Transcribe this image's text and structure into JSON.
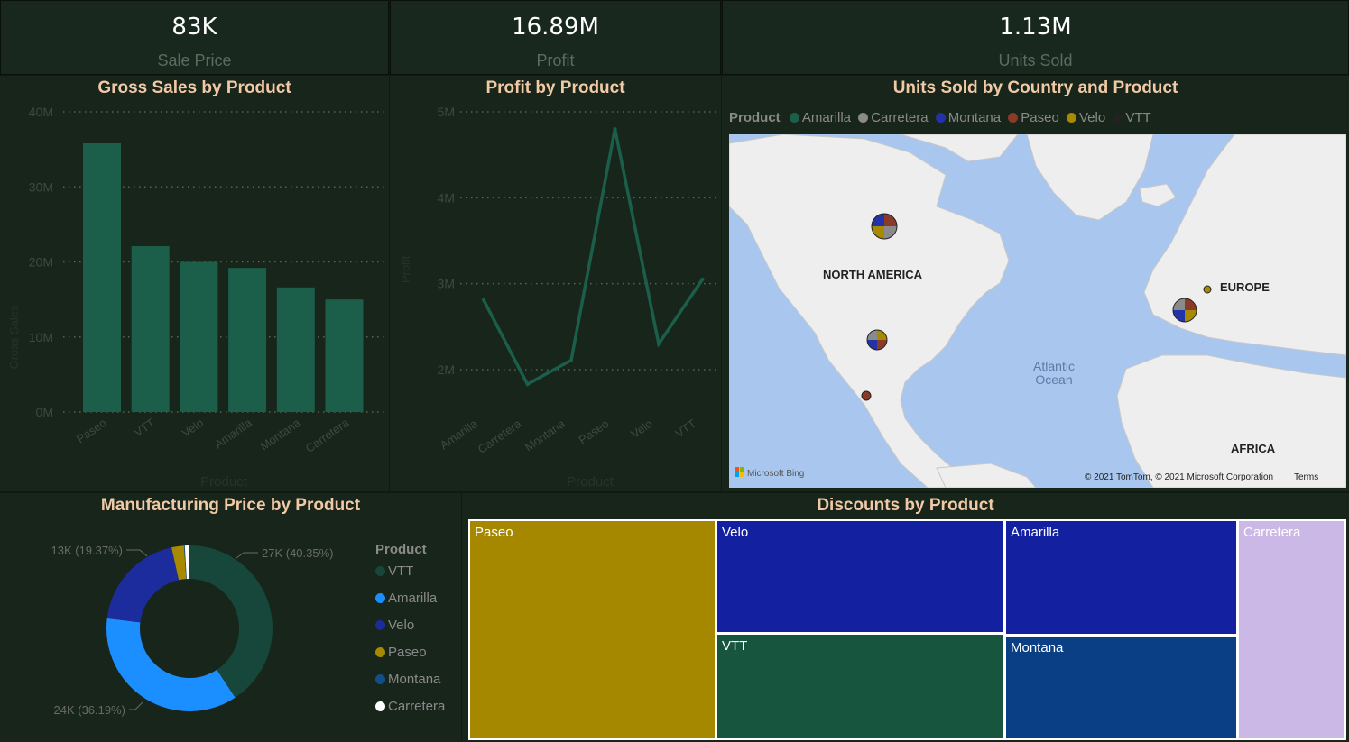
{
  "kpis": [
    {
      "value": "83K",
      "label": "Sale Price"
    },
    {
      "value": "16.89M",
      "label": "Profit"
    },
    {
      "value": "1.13M",
      "label": "Units Sold"
    }
  ],
  "gross_sales": {
    "title": "Gross Sales by Product",
    "y_ticks": [
      "0M",
      "10M",
      "20M",
      "30M",
      "40M"
    ],
    "xlabel": "Product",
    "ylabel": "Gross Sales"
  },
  "profit": {
    "title": "Profit by Product",
    "y_ticks": [
      "2M",
      "3M",
      "4M",
      "5M"
    ],
    "xlabel": "Product",
    "ylabel": "Profit"
  },
  "map": {
    "title": "Units Sold by Country and Product",
    "legend_title": "Product",
    "legend": [
      {
        "name": "Amarilla",
        "color": "#1b5e4a"
      },
      {
        "name": "Carretera",
        "color": "#8a8a8a"
      },
      {
        "name": "Montana",
        "color": "#2233aa"
      },
      {
        "name": "Paseo",
        "color": "#8b3a2a"
      },
      {
        "name": "Velo",
        "color": "#a88a00"
      },
      {
        "name": "VTT",
        "color": "#222222"
      }
    ],
    "labels": {
      "north_america": "NORTH AMERICA",
      "europe": "EUROPE",
      "atlantic": "Atlantic",
      "ocean": "Ocean",
      "africa": "AFRICA"
    },
    "bing": "Microsoft Bing",
    "copyright": "© 2021 TomTom, © 2021 Microsoft Corporation",
    "terms": "Terms"
  },
  "manufacturing": {
    "title": "Manufacturing Price by Product",
    "legend_title": "Product",
    "legend": [
      {
        "name": "VTT",
        "color": "#17463a"
      },
      {
        "name": "Amarilla",
        "color": "#1b8fff"
      },
      {
        "name": "Velo",
        "color": "#1c2c9c"
      },
      {
        "name": "Paseo",
        "color": "#a88a00"
      },
      {
        "name": "Montana",
        "color": "#114f8a"
      },
      {
        "name": "Carretera",
        "color": "#ffffff"
      }
    ],
    "labels": {
      "vtt": "27K (40.35%)",
      "amarilla": "24K (36.19%)",
      "velo": "13K (19.37%)"
    }
  },
  "discounts": {
    "title": "Discounts by Product",
    "tiles": [
      "Paseo",
      "Velo",
      "Amarilla",
      "Carretera",
      "VTT",
      "Montana"
    ]
  },
  "chart_data": [
    {
      "type": "bar",
      "title": "Gross Sales by Product",
      "xlabel": "Product",
      "ylabel": "Gross Sales",
      "categories": [
        "Paseo",
        "VTT",
        "Velo",
        "Amarilla",
        "Montana",
        "Carretera"
      ],
      "values": [
        35.8,
        22.1,
        20.0,
        19.2,
        16.6,
        15.0
      ],
      "unit": "M",
      "ylim": [
        0,
        40
      ],
      "color": "#1b5e4a",
      "grid": true
    },
    {
      "type": "line",
      "title": "Profit by Product",
      "xlabel": "Product",
      "ylabel": "Profit",
      "categories": [
        "Amarilla",
        "Carretera",
        "Montana",
        "Paseo",
        "Velo",
        "VTT"
      ],
      "values": [
        2.81,
        1.83,
        2.11,
        4.8,
        2.3,
        3.05
      ],
      "unit": "M",
      "ylim": [
        1.5,
        5
      ],
      "color": "#1b5e4a",
      "grid": true
    },
    {
      "type": "pie",
      "title": "Manufacturing Price by Product",
      "categories": [
        "VTT",
        "Amarilla",
        "Velo",
        "Paseo",
        "Montana",
        "Carretera"
      ],
      "values": [
        27,
        24,
        13,
        1.6,
        0.1,
        0.6
      ],
      "percent": [
        40.35,
        36.19,
        19.37,
        2.4,
        0.15,
        0.9
      ],
      "unit": "K",
      "colors": [
        "#17463a",
        "#1b8fff",
        "#1c2c9c",
        "#a88a00",
        "#114f8a",
        "#ffffff"
      ],
      "donut": true
    },
    {
      "type": "treemap",
      "title": "Discounts by Product",
      "categories": [
        "Paseo",
        "Velo",
        "Amarilla",
        "Carretera",
        "VTT",
        "Montana"
      ],
      "colors": [
        "#a58800",
        "#1321a0",
        "#1321a0",
        "#cbb8e6",
        "#17553f",
        "#0b3f85"
      ]
    }
  ]
}
